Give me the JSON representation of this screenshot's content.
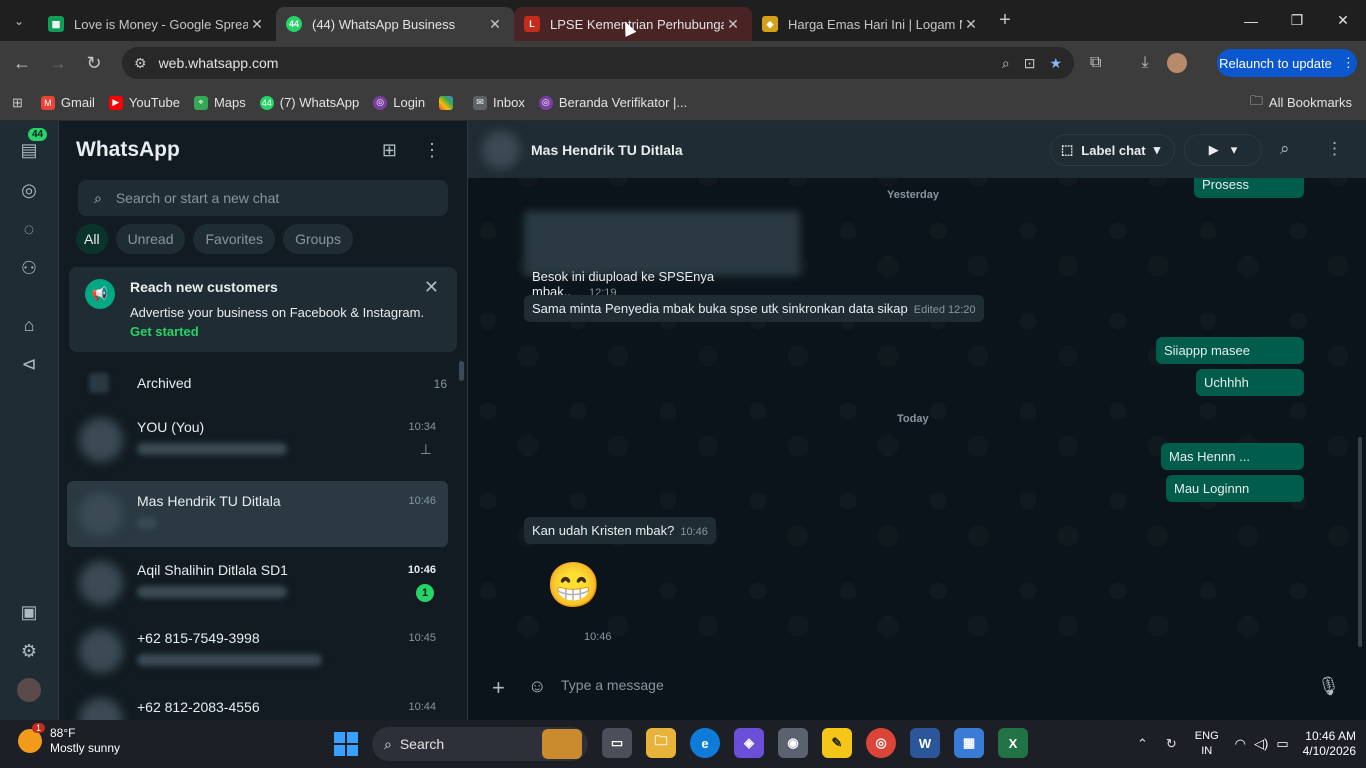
{
  "browser": {
    "tabs": [
      {
        "title": "Love is Money - Google Spreadsheets",
        "favicon": "sheets-icon",
        "color": "#0f9d58"
      },
      {
        "title": "(44) WhatsApp Business",
        "favicon": "whatsapp-icon",
        "color": "#25d366"
      },
      {
        "title": "LPSE Kementrian Perhubungan",
        "favicon": "lpse-icon",
        "color": "#c42b1c"
      },
      {
        "title": "Harga Emas Hari Ini | Logam Mulia",
        "favicon": "gold-icon",
        "color": "#d4a017"
      }
    ],
    "url": "web.whatsapp.com",
    "relaunch_label": "Relaunch to update",
    "bookmarks": [
      "Gmail",
      "YouTube",
      "Maps",
      "(7) WhatsApp",
      "Login",
      "",
      "Inbox",
      "Beranda Verifikator |..."
    ],
    "all_bookmarks": "All Bookmarks"
  },
  "whatsapp": {
    "rail_badge": "44",
    "title": "WhatsApp",
    "search_placeholder": "Search or start a new chat",
    "filters": [
      "All",
      "Unread",
      "Favorites",
      "Groups"
    ],
    "promo": {
      "heading": "Reach new customers",
      "sub": "Advertise your business on Facebook & Instagram.",
      "cta": "Get started"
    },
    "archived": {
      "label": "Archived",
      "count": "16"
    },
    "chats": [
      {
        "name": "YOU (You)",
        "time": "10:34",
        "pinned": true
      },
      {
        "name": "Mas Hendrik TU Ditlala",
        "time": "10:46",
        "selected": true
      },
      {
        "name": "Aqil Shalihin Ditlala SD1",
        "time": "10:46",
        "unread": "1"
      },
      {
        "name": "+62 815-7549-3998",
        "time": "10:45"
      },
      {
        "name": "+62 812-2083-4556",
        "time": "10:44"
      }
    ],
    "conversation": {
      "contact": "Mas Hendrik TU Ditlala",
      "label_chat": "Label chat",
      "dates": [
        "Yesterday",
        "Today"
      ],
      "messages": [
        {
          "dir": "out",
          "text": "Prosess",
          "time": ""
        },
        {
          "dir": "in",
          "text": "Besok ini diupload ke SPSEnya mbak..",
          "time": "12:19"
        },
        {
          "dir": "in",
          "text": "Sama minta Penyedia mbak buka spse utk sinkronkan data sikap",
          "time": "Edited 12:20"
        },
        {
          "dir": "out",
          "text": "Siiappp masee",
          "time": ""
        },
        {
          "dir": "out",
          "text": "Uchhhh",
          "time": ""
        },
        {
          "dir": "out",
          "text": "Mas Hennn ...",
          "time": ""
        },
        {
          "dir": "out",
          "text": "Mau Loginnn",
          "time": ""
        },
        {
          "dir": "in",
          "text": "Kan udah Kristen mbak?",
          "time": "10:46"
        },
        {
          "dir": "in",
          "text": "😁",
          "time": "10:46"
        }
      ],
      "composer_placeholder": "Type a message"
    }
  },
  "taskbar": {
    "weather_temp": "88°F",
    "weather_desc": "Mostly sunny",
    "weather_badge": "1",
    "search_label": "Search",
    "lang1": "ENG",
    "lang2": "IN",
    "time": "10:46 AM",
    "date": "4/10/2026"
  }
}
